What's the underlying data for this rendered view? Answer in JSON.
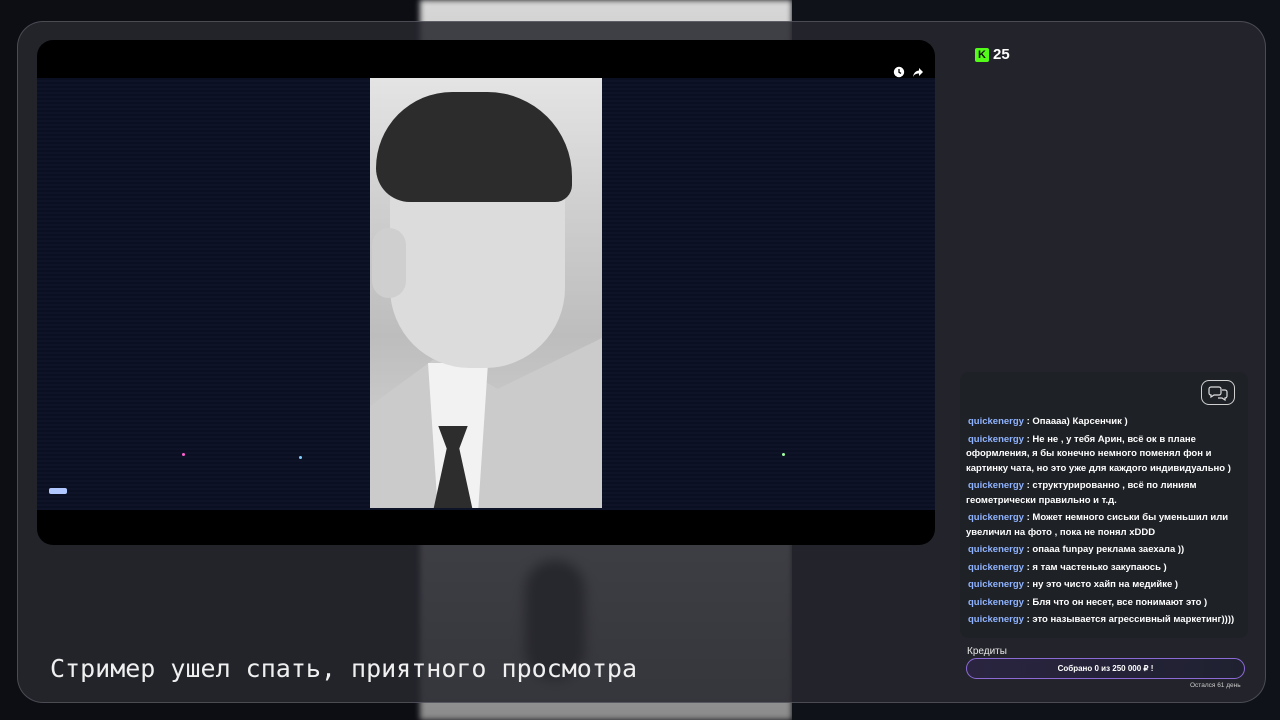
{
  "top_stats": {
    "viewer_count": "25",
    "logo_letter": "K"
  },
  "player": {
    "clock_icon": "clock-icon",
    "share_icon": "share-icon"
  },
  "chat": {
    "messages": [
      {
        "user": "quickenergy",
        "text": " : Опаааа) Карсенчик )"
      },
      {
        "user": "quickenergy",
        "text": " : Не не , у тебя Арин, всё ок в плане оформления, я бы конечно немного поменял фон и картинку чата, но это уже для каждого индивидуально )"
      },
      {
        "user": "quickenergy",
        "text": " : структурированно , всё по линиям геометрически правильно и т.д."
      },
      {
        "user": "quickenergy",
        "text": " : Может немного сиськи бы уменьшил или увеличил на фото , пока не понял xDDD"
      },
      {
        "user": "quickenergy",
        "text": " : опааа funpay реклама заехала ))"
      },
      {
        "user": "quickenergy",
        "text": " : я там частенько закупаюсь )"
      },
      {
        "user": "quickenergy",
        "text": " : ну это чисто хайп на медийке )"
      },
      {
        "user": "quickenergy",
        "text": " : Бля что он несет, все понимают это )"
      },
      {
        "user": "quickenergy",
        "text": " : это называется агрессивный маркетинг))))"
      }
    ]
  },
  "donation": {
    "label": "Кредиты",
    "progress_text": "Собрано 0  из 250 000 ₽ !",
    "collected": 0,
    "goal": 250000,
    "days_left": "Остался 61 день",
    "accent_color": "#8c6ad6"
  },
  "overlay": {
    "message": "Стример ушел спать, приятного просмотра"
  },
  "colors": {
    "nick": "#8fb3ff",
    "kick_green": "#53fc18"
  }
}
